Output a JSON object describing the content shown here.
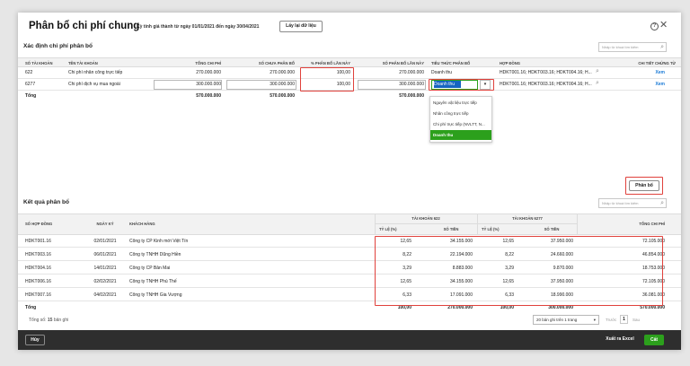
{
  "dialog": {
    "title": "Phân bổ chi phí chung",
    "period": "Kỳ tính giá thành từ ngày 01/01/2021 đến ngày 30/04/2021",
    "refresh_label": "Lấy lại dữ liệu",
    "help_icon": "?",
    "close_icon": "✕"
  },
  "allocation": {
    "title": "Xác định chi phí phân bổ",
    "search_placeholder": "Nhập từ khoá tìm kiếm",
    "columns": [
      "SỐ TÀI KHOẢN",
      "TÊN TÀI KHOẢN",
      "TỔNG CHI PHÍ",
      "SỐ CHƯA PHÂN BỔ",
      "% PHÂN BỔ LẦN NÀY",
      "SỐ PHÂN BỔ LẦN NÀY",
      "TIÊU THỨC PHÂN BỔ",
      "HỢP ĐỒNG",
      "CHI TIẾT CHỨNG TỪ"
    ],
    "rows": [
      {
        "account": "622",
        "name": "Chi phí nhân công trực tiếp",
        "total": "270.000.000",
        "unallocated": "270.000.000",
        "percent": "100,00",
        "amount": "270.000.000",
        "criteria": "Doanh thu",
        "contracts": "HDKT001.16; HDKT003.16; HDKT004.16; H...",
        "detail": "Xem"
      },
      {
        "account": "6277",
        "name": "Chi phí dịch vụ mua ngoài",
        "total": "300.000.000",
        "unallocated": "300.000.000",
        "percent": "100,00",
        "amount": "300.000.000",
        "criteria": "Doanh thu",
        "contracts": "HDKT001.16; HDKT003.16; HDKT004.16; H...",
        "detail": "Xem"
      }
    ],
    "total_label": "Tổng",
    "total_cost": "570.000.000",
    "total_unallocated": "570.000.000",
    "total_amount": "570.000.000"
  },
  "criteria_dropdown": {
    "options": [
      "Nguyên vật liệu trực tiếp",
      "Nhân công trực tiếp",
      "Chi phí trực tiếp (NVLTT, N...",
      "Doanh thu"
    ],
    "selected": "Doanh thu",
    "toggle": "▾"
  },
  "allocate_button": "Phân bổ",
  "result": {
    "title": "Kết quả phân bổ",
    "search_placeholder": "Nhập từ khoá tìm kiếm",
    "col_contract": "SỐ HỢP ĐỒNG",
    "col_date": "NGÀY KÝ",
    "col_customer": "KHÁCH HÀNG",
    "group_622": "TÀI KHOẢN 622",
    "group_6277": "TÀI KHOẢN 6277",
    "col_ratio": "TỶ LỆ (%)",
    "col_amount": "SỐ TIỀN",
    "col_total": "TỔNG CHI PHÍ",
    "rows": [
      {
        "contract": "HDKT001.16",
        "date": "02/01/2021",
        "customer": "Công ty CP Kinh mới Việt Tín",
        "r1": "12,65",
        "a1": "34.155.000",
        "r2": "12,65",
        "a2": "37.950.000",
        "total": "72.105.000"
      },
      {
        "contract": "HDKT003.16",
        "date": "06/01/2021",
        "customer": "Công ty TNHH Dũng Hiền",
        "r1": "8,22",
        "a1": "22.194.000",
        "r2": "8,22",
        "a2": "24.660.000",
        "total": "46.854.000"
      },
      {
        "contract": "HDKT004.16",
        "date": "14/01/2021",
        "customer": "Công ty CP Bản Mai",
        "r1": "3,29",
        "a1": "8.883.000",
        "r2": "3,29",
        "a2": "9.870.000",
        "total": "18.753.000"
      },
      {
        "contract": "HDKT006.16",
        "date": "02/02/2021",
        "customer": "Công ty TNHH Phú Thế",
        "r1": "12,65",
        "a1": "34.155.000",
        "r2": "12,65",
        "a2": "37.950.000",
        "total": "72.105.000"
      },
      {
        "contract": "HDKT007.16",
        "date": "04/02/2021",
        "customer": "Công ty TNHH Gia Vượng",
        "r1": "6,33",
        "a1": "17.091.000",
        "r2": "6,33",
        "a2": "18.990.000",
        "total": "36.081.000"
      }
    ],
    "total_label": "Tổng",
    "total_r1": "100,00",
    "total_a1": "270.000.000",
    "total_r2": "100,00",
    "total_a2": "300.000.000",
    "total_total": "570.000.000"
  },
  "pagination": {
    "record_prefix": "Tổng số:",
    "record_count": "15",
    "record_suffix": "bản ghi",
    "per_page": "20 bản ghi trên 1 trang",
    "prev": "Trước",
    "page": "1",
    "next": "Sau"
  },
  "footer": {
    "cancel": "Hủy",
    "export": "Xuất ra Excel",
    "save": "Cất"
  },
  "colors": {
    "accent": "#2ca01c",
    "highlight": "#e0413c",
    "link": "#1a7ad6",
    "footer_bg": "#2e2e2e"
  }
}
